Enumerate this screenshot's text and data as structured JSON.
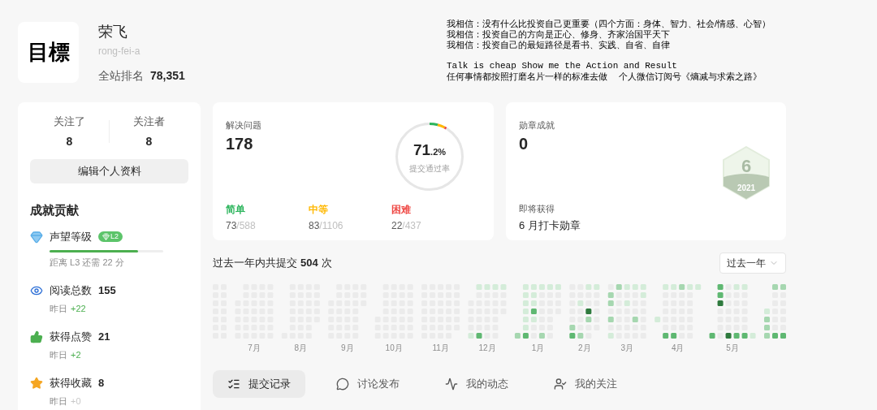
{
  "profile": {
    "avatar_text": "目標",
    "name": "荣飞",
    "handle": "rong-fei-a",
    "rank_label": "全站排名",
    "rank_value": "78,351"
  },
  "motto": [
    {
      "kind": "cjk",
      "text": "我相信：没有什么比投资自己更重要（四个方面：身体、智力、社会/情感、心智）"
    },
    {
      "kind": "cjk",
      "text": "我相信：投资自己的方向是正心、修身、齐家治国平天下"
    },
    {
      "kind": "cjk",
      "text": "我相信：投资自己的最短路径是看书、实践、自省、自律"
    },
    {
      "kind": "mono",
      "text": "Talk is cheap Show me the Action and Result"
    },
    {
      "kind": "cjk",
      "text": "任何事情都按照打磨名片一样的标准去做　 个人微信订阅号《熵减与求索之路》"
    }
  ],
  "follow": [
    {
      "label": "关注了",
      "value": "8"
    },
    {
      "label": "关注者",
      "value": "8"
    }
  ],
  "edit_button": "编辑个人资料",
  "achievements": {
    "title": "成就贡献",
    "items": [
      {
        "kind": "level",
        "label": "声望等级",
        "badge": "L2",
        "level": 0.78,
        "note": "距离 L3 还需 22 分"
      },
      {
        "kind": "views",
        "label": "阅读总数",
        "value": "155",
        "note_label": "昨日",
        "delta": "+22",
        "positive": true
      },
      {
        "kind": "likes",
        "label": "获得点赞",
        "value": "21",
        "note_label": "昨日",
        "delta": "+2",
        "positive": true
      },
      {
        "kind": "favorites",
        "label": "获得收藏",
        "value": "8",
        "note_label": "昨日",
        "delta": "+0",
        "positive": false
      }
    ]
  },
  "solved": {
    "label": "解决问题",
    "value": "178",
    "rate_main": "71",
    "rate_decimal": ".2%",
    "rate_label": "提交通过率",
    "difficulties": [
      {
        "label": "简单",
        "solved": "73",
        "total": "/588",
        "color": "#2db55d"
      },
      {
        "label": "中等",
        "solved": "83",
        "total": "/1106",
        "color": "#ffb800"
      },
      {
        "label": "困难",
        "solved": "22",
        "total": "/437",
        "color": "#ef4743"
      }
    ]
  },
  "badges": {
    "label": "勋章成就",
    "value": "0",
    "badge_number": "6",
    "badge_year": "2021",
    "upcoming_label": "即将获得",
    "upcoming_name": "6 月打卡勋章"
  },
  "heatmap": {
    "title_prefix": "过去一年内共提交",
    "count": "504",
    "title_suffix": "次",
    "range": "过去一年",
    "months": [
      "7月",
      "8月",
      "9月",
      "10月",
      "11月",
      "12月",
      "1月",
      "2月",
      "3月",
      "4月",
      "5月"
    ]
  },
  "tabs": [
    {
      "kind": "list",
      "label": "提交记录",
      "selected": true
    },
    {
      "kind": "discuss",
      "label": "讨论发布",
      "selected": false
    },
    {
      "kind": "activity",
      "label": "我的动态",
      "selected": false
    },
    {
      "kind": "follow",
      "label": "我的关注",
      "selected": false
    }
  ]
}
